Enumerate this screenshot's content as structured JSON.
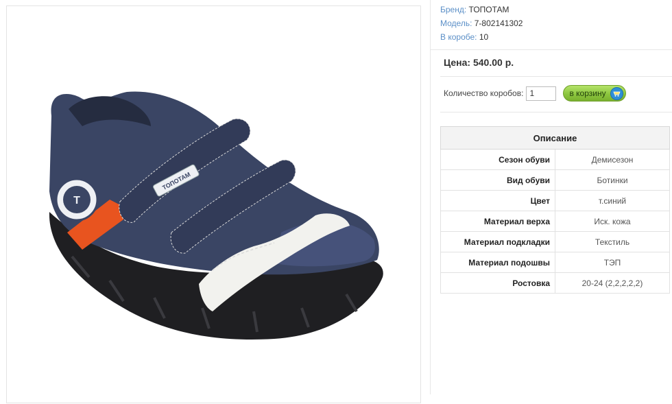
{
  "product": {
    "image_alt": "Ботинки ТОПОТАМ",
    "logo_text": "ТОПОТАМ"
  },
  "meta": {
    "brand_label": "Бренд:",
    "brand_value": "ТОПОТАМ",
    "model_label": "Модель:",
    "model_value": "7-802141302",
    "box_label": "В коробе:",
    "box_value": "10"
  },
  "price": {
    "text": "Цена: 540.00 р."
  },
  "order": {
    "qty_label": "Количество коробов:",
    "qty_value": "1",
    "cart_label": "в корзину"
  },
  "description": {
    "title": "Описание",
    "rows": [
      {
        "key": "Сезон обуви",
        "value": "Демисезон"
      },
      {
        "key": "Вид обуви",
        "value": "Ботинки"
      },
      {
        "key": "Цвет",
        "value": "т.синий"
      },
      {
        "key": "Материал верха",
        "value": "Иск. кожа"
      },
      {
        "key": "Материал подкладки",
        "value": "Текстиль"
      },
      {
        "key": "Материал подошвы",
        "value": "ТЭП"
      },
      {
        "key": "Ростовка",
        "value": "20-24 (2,2,2,2,2)"
      }
    ]
  },
  "colors": {
    "link": "#5b8fc7",
    "button": "#8cc63f",
    "shoe": "#3a4564",
    "accent": "#e8541f"
  }
}
